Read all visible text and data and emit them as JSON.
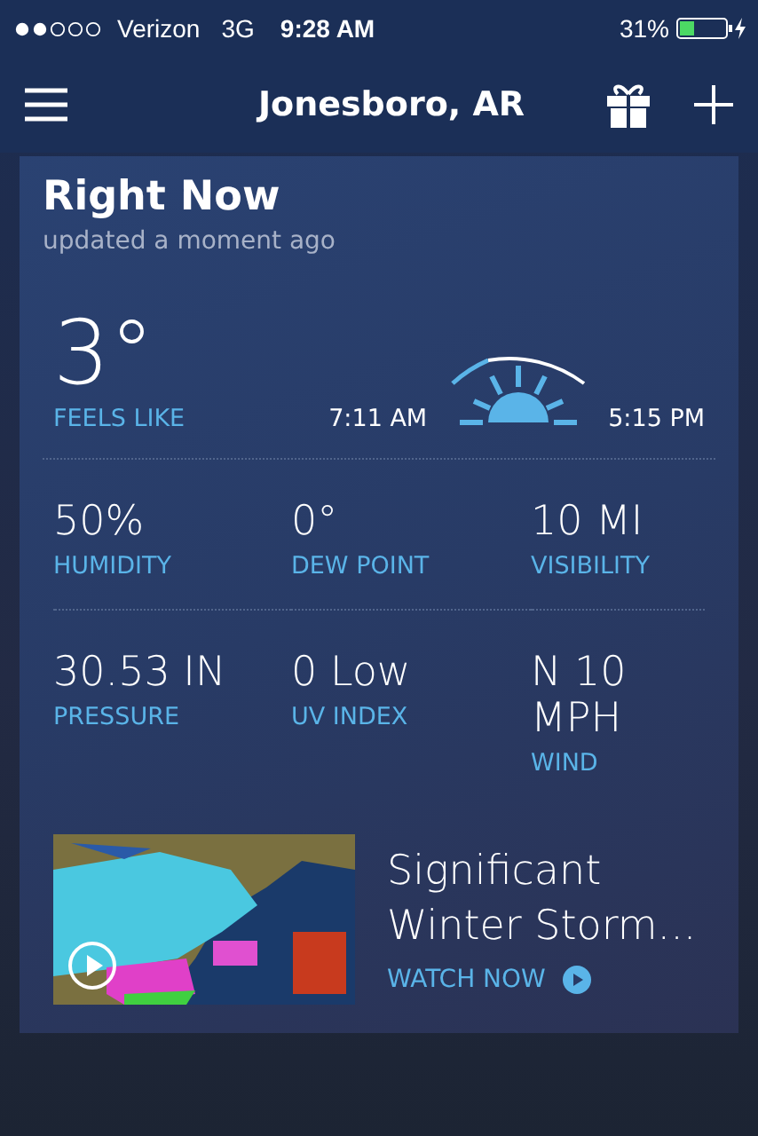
{
  "status_bar": {
    "carrier": "Verizon",
    "network": "3G",
    "time": "9:28 AM",
    "battery": "31%"
  },
  "header": {
    "title": "Jonesboro, AR"
  },
  "card": {
    "title": "Right Now",
    "subtitle": "updated a moment ago",
    "temperature": "3°",
    "temperature_label": "FEELS LIKE",
    "sunrise": "7:11 AM",
    "sunset": "5:15 PM",
    "stats": [
      {
        "value": "50%",
        "label": "HUMIDITY"
      },
      {
        "value": "0°",
        "label": "DEW POINT"
      },
      {
        "value": "10 MI",
        "label": "VISIBILITY"
      },
      {
        "value": "30.53 IN",
        "label": "PRESSURE"
      },
      {
        "value": "0 Low",
        "label": "UV INDEX"
      },
      {
        "value": "N 10 MPH",
        "label": "WIND"
      }
    ],
    "video": {
      "kind": "picture",
      "title": "Significant Winter Storm...",
      "action": "WATCH NOW"
    }
  }
}
